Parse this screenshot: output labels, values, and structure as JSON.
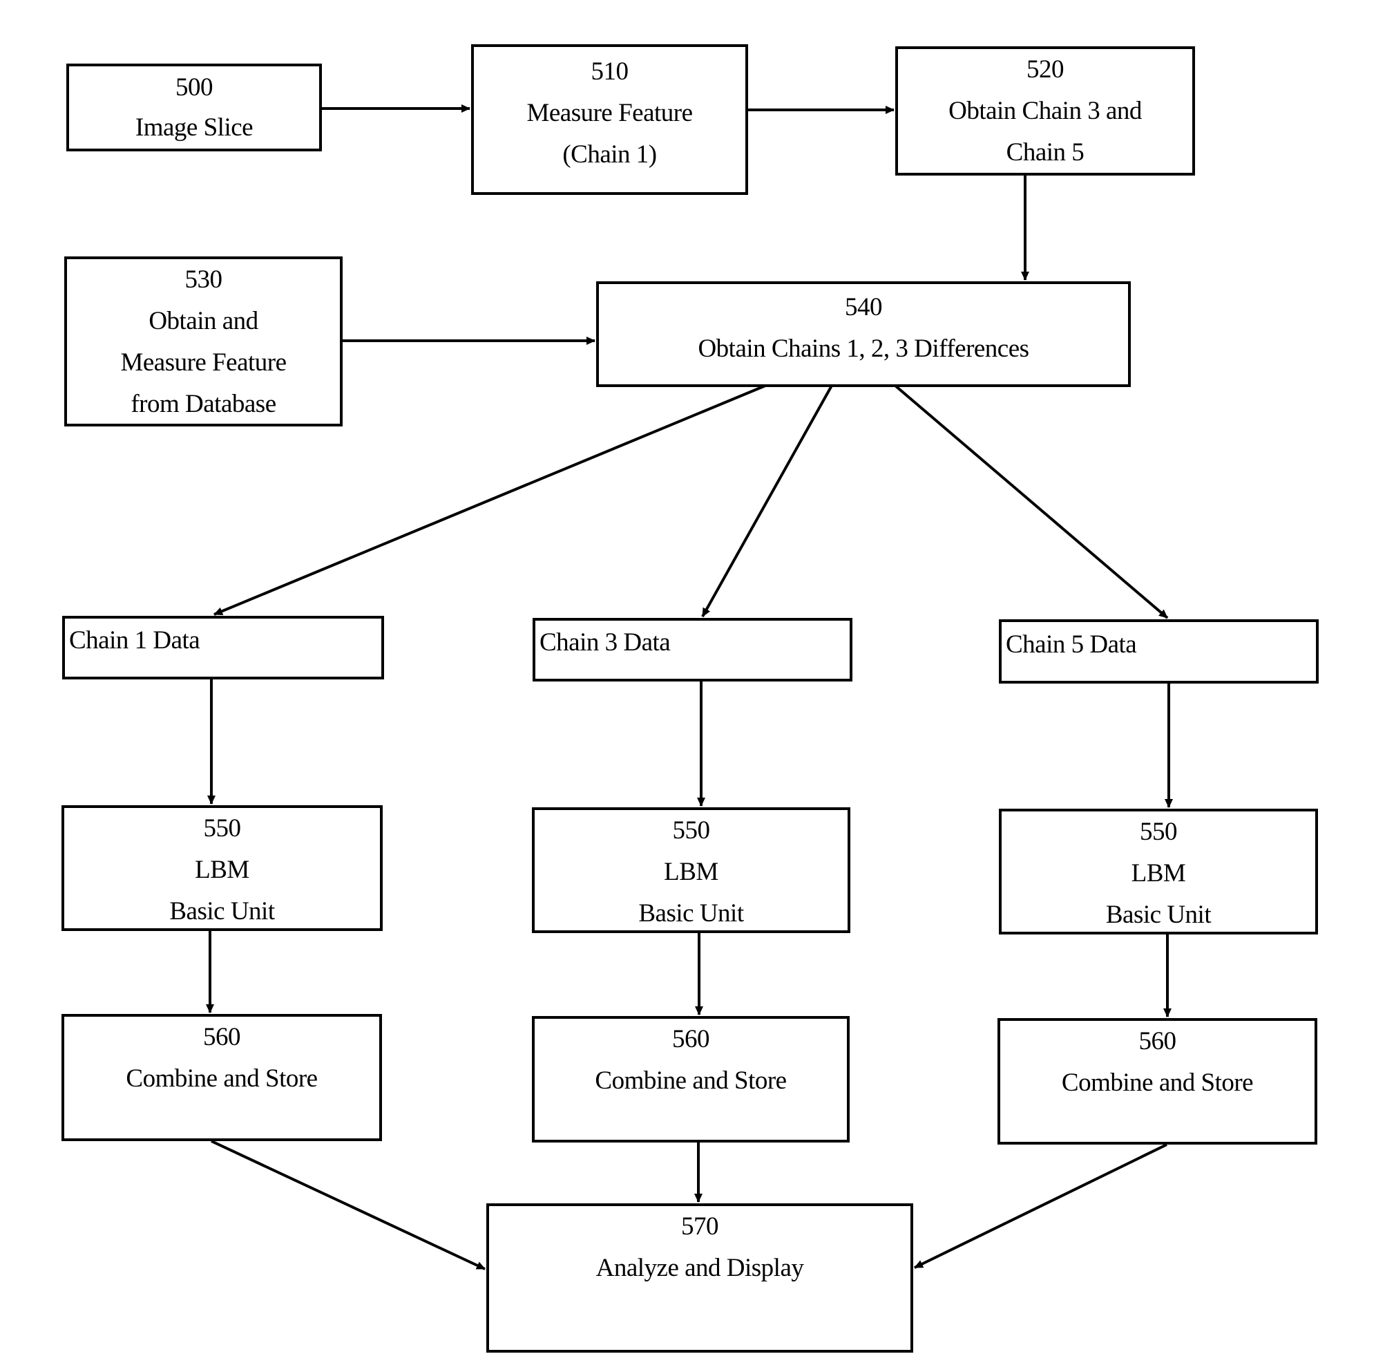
{
  "diagram": {
    "nodes": [
      {
        "id": "n500",
        "lines": [
          "500",
          "Image Slice"
        ]
      },
      {
        "id": "n510",
        "lines": [
          "510",
          "Measure Feature",
          "(Chain 1)"
        ]
      },
      {
        "id": "n520",
        "lines": [
          "520",
          "Obtain Chain 3 and",
          "Chain 5"
        ]
      },
      {
        "id": "n530",
        "lines": [
          "530",
          "Obtain and",
          "Measure Feature",
          "from Database"
        ]
      },
      {
        "id": "n540",
        "lines": [
          "540",
          "Obtain Chains 1, 2, 3 Differences"
        ]
      },
      {
        "id": "c1",
        "lines": [
          "Chain 1 Data"
        ]
      },
      {
        "id": "c3",
        "lines": [
          "Chain 3 Data"
        ]
      },
      {
        "id": "c5",
        "lines": [
          "Chain 5 Data"
        ]
      },
      {
        "id": "n550a",
        "lines": [
          "550",
          "LBM",
          "Basic Unit"
        ]
      },
      {
        "id": "n550b",
        "lines": [
          "550",
          "LBM",
          "Basic Unit"
        ]
      },
      {
        "id": "n550c",
        "lines": [
          "550",
          "LBM",
          "Basic Unit"
        ]
      },
      {
        "id": "n560a",
        "lines": [
          "560",
          "Combine and Store"
        ]
      },
      {
        "id": "n560b",
        "lines": [
          "560",
          "Combine and Store"
        ]
      },
      {
        "id": "n560c",
        "lines": [
          "560",
          "Combine and Store"
        ]
      },
      {
        "id": "n570",
        "lines": [
          "570",
          "Analyze and Display"
        ]
      }
    ],
    "edges": [
      {
        "from": "n500",
        "to": "n510"
      },
      {
        "from": "n510",
        "to": "n520"
      },
      {
        "from": "n520",
        "to": "n540"
      },
      {
        "from": "n530",
        "to": "n540"
      },
      {
        "from": "n540",
        "to": "c1"
      },
      {
        "from": "n540",
        "to": "c3"
      },
      {
        "from": "n540",
        "to": "c5"
      },
      {
        "from": "c1",
        "to": "n550a"
      },
      {
        "from": "c3",
        "to": "n550b"
      },
      {
        "from": "c5",
        "to": "n550c"
      },
      {
        "from": "n550a",
        "to": "n560a"
      },
      {
        "from": "n550b",
        "to": "n560b"
      },
      {
        "from": "n550c",
        "to": "n560c"
      },
      {
        "from": "n560a",
        "to": "n570"
      },
      {
        "from": "n560b",
        "to": "n570"
      },
      {
        "from": "n560c",
        "to": "n570"
      }
    ]
  }
}
